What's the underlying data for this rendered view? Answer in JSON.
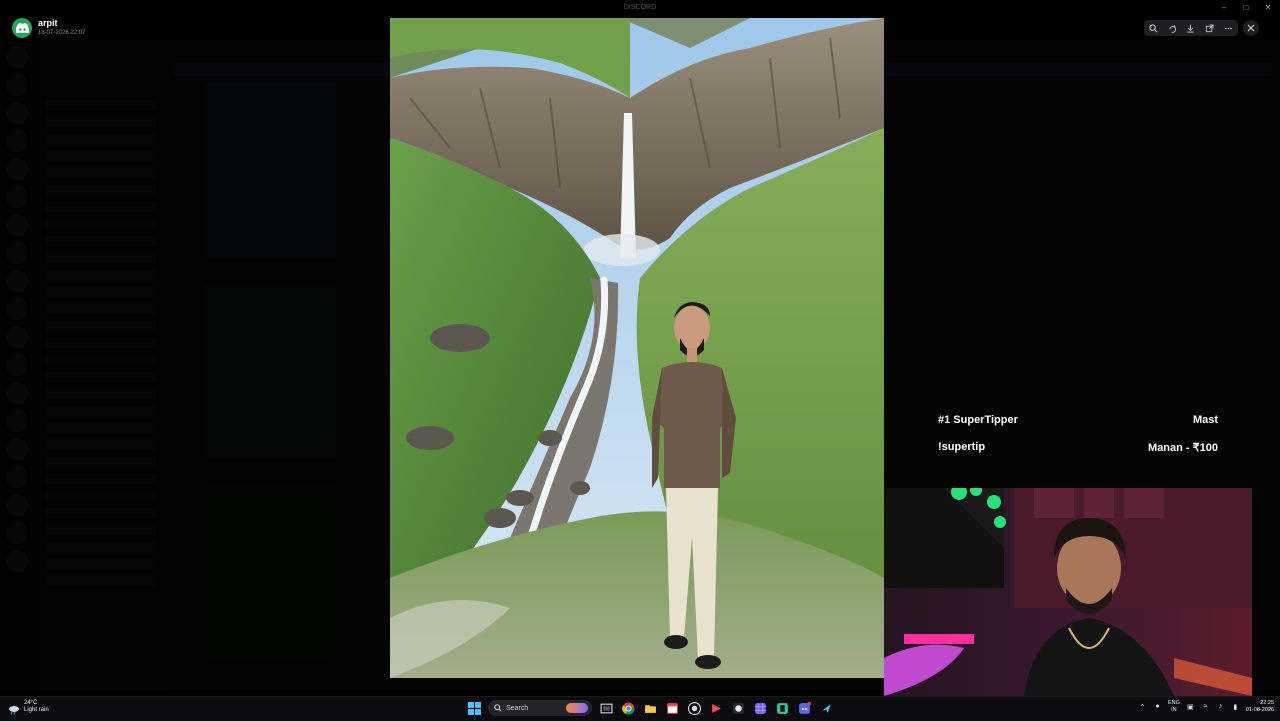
{
  "app": {
    "title": "DISCORD",
    "uploader": "arpit",
    "upload_date": "18-07-2026 22:07"
  },
  "viewer_toolbar": {
    "icons": [
      "zoom-icon",
      "rotate-icon",
      "download-icon",
      "open-external-icon",
      "more-icon"
    ],
    "close_icon": "close-icon"
  },
  "stream_overlay": {
    "top_tipper_label": "#1 SuperTipper",
    "top_tipper_name": "Mast",
    "command": "!supertip",
    "latest_tip": "Manan - ₹100"
  },
  "taskbar": {
    "weather_temp": "24°C",
    "weather_desc": "Light rain",
    "search_label": "Search",
    "lang_line1": "ENG",
    "lang_line2": "IN",
    "time": "22:25",
    "date": "01-08-2026"
  },
  "colors": {
    "discord_green": "#23a55a",
    "overlay_text": "#ffffff",
    "taskbar_bg": "#0c0c10"
  }
}
